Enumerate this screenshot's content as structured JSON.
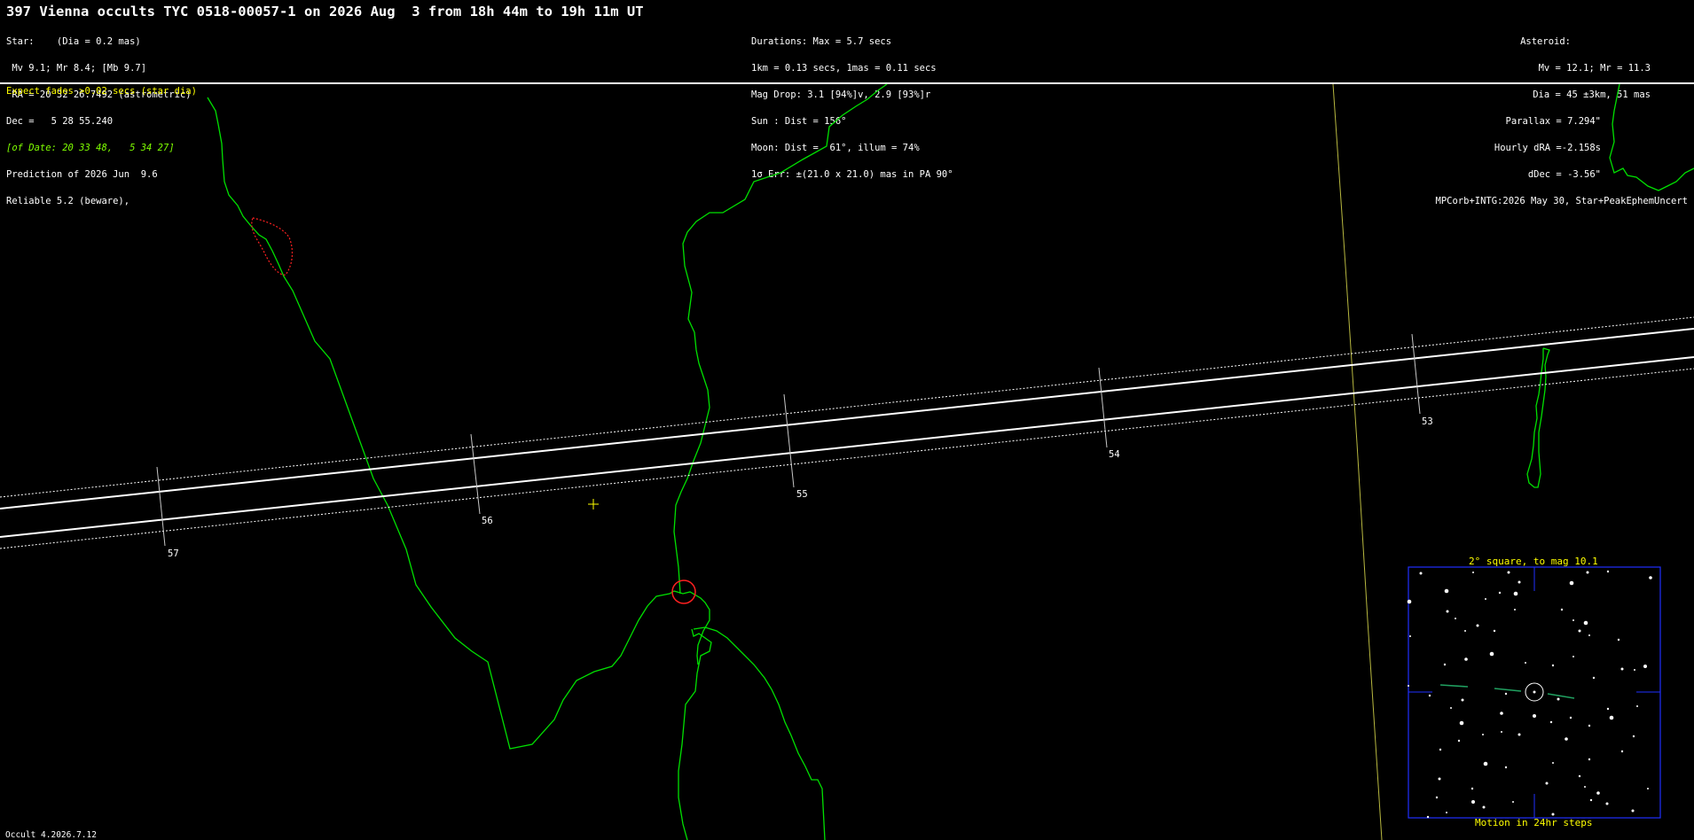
{
  "title": "397 Vienna occults TYC 0518-00057-1 on 2026 Aug  3 from 18h 44m to 19h 11m UT",
  "star_block": {
    "lines": [
      "Star:    (Dia = 0.2 mas)",
      " Mv 9.1; Mr 8.4; [Mb 9.7]",
      " RA = 20 32 26.7492 (astrometric)",
      "Dec =   5 28 55.240"
    ],
    "of_date": "[of Date: 20 33 48,   5 34 27]",
    "lines2": [
      "Prediction of 2026 Jun  9.6",
      "Reliable 5.2 (beware),"
    ]
  },
  "event_block": {
    "lines": [
      "Durations: Max = 5.7 secs",
      "1km = 0.13 secs, 1mas = 0.11 secs",
      "Mag Drop: 3.1 [94%]v, 2.9 [93%]r",
      "Sun : Dist = 156°",
      "Moon: Dist =  61°, illum = 74%",
      "1σ Err: ±(21.0 x 21.0) mas in PA 90°"
    ]
  },
  "asteroid_block": {
    "lines": [
      "Asteroid:",
      "Mv = 12.1; Mr = 11.3",
      "Dia = 45 ±3km, 51 mas",
      "Parallax = 7.294\"",
      "Hourly dRA =-2.158s",
      "dDec = -3.56\"",
      "MPCorb+INTG:2026 May 30, Star+PeakEphemUncert"
    ]
  },
  "fade_note": "Expect fades >0.02 secs (star dia)",
  "time_ticks": [
    "57",
    "56",
    "55",
    "54",
    "53"
  ],
  "finder": {
    "title": "2° square, to mag 10.1",
    "footer": "Motion in 24hr steps"
  },
  "version": "Occult 4.2026.7.12",
  "colors": {
    "background": "#000000",
    "coastline": "#00e000",
    "path_line": "#ffffff",
    "header_text": "#ffffff",
    "note_text": "#ffff00",
    "finder_frame": "#0000ff",
    "target_marker": "#ff0000"
  }
}
